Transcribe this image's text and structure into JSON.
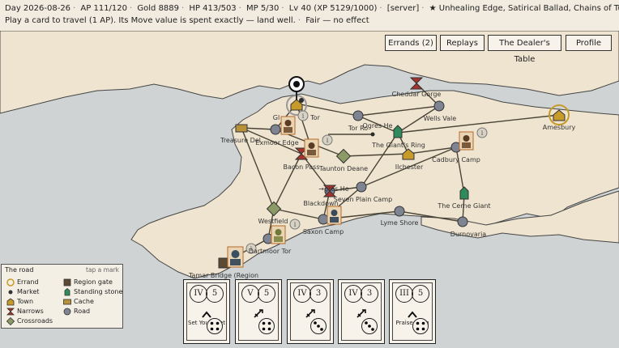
{
  "status": {
    "day": "Day 2026-08-26",
    "ap": "AP 111/120",
    "gold": "Gold 8889",
    "hp": "HP 413/503",
    "mp": "MP 5/30",
    "level": "Lv 40 (XP 5129/1000)",
    "server": "[server]",
    "traits": "★ Unhealing Edge, Satirical Ballad, Chains of Turquine",
    "message": "Play a card to travel (1 AP). Its Move value is spent exactly — land well.",
    "weather": "Fair — no effect"
  },
  "nav": {
    "errands": "Errands (2)",
    "replays": "Replays",
    "dealers_table": "The Dealer's Table",
    "profile": "Profile"
  },
  "places": {
    "cheddar": "Cheddar Gorge",
    "wells": "Wells Vale",
    "amesbury": "Amesbury",
    "tor": "Tor",
    "glastonbury": "Gl",
    "torroad": "Tor Ro",
    "ogreshe": "Ogres He",
    "giants_ring": "The Giant's Ring",
    "exmoor": "Exmoor Edge",
    "treasure": "Treasure Del",
    "ilchester": "Ilchester",
    "cadbury": "Cadbury Camp",
    "bacon": "Bacon Pass",
    "taunton": "Taunton Deane",
    "ogres_h2": "→gres He",
    "blackdown": "Blackdown",
    "seven": "Seven Plain Camp",
    "cerne": "The Cerne Giant",
    "westfield": "Westfield",
    "lyme": "Lyme Shore",
    "saxon": "Saxon Camp",
    "dartmoor": "Dartmoor Tor",
    "durnovaria": "Durnovaria",
    "tamar": "Tamar Bridge (Region"
  },
  "legend": {
    "title": "The road",
    "hint": "tap a mark",
    "items": [
      "Errand",
      "Market",
      "Town",
      "Narrows",
      "Crossroads",
      "Region gate",
      "Standing stone",
      "Cache",
      "Road"
    ]
  },
  "cards": [
    {
      "rank": "IV",
      "move": "5",
      "name": "Set Your Feet",
      "icon": "chevron",
      "die": 4
    },
    {
      "rank": "V",
      "move": "5",
      "name": "",
      "icon": "sword",
      "die": 4
    },
    {
      "rank": "IV",
      "move": "3",
      "name": "",
      "icon": "sword",
      "die": 3
    },
    {
      "rank": "IV",
      "move": "3",
      "name": "",
      "icon": "sword",
      "die": 3
    },
    {
      "rank": "III",
      "move": "5",
      "name": "Praise Song",
      "icon": "chevron",
      "die": 4
    }
  ],
  "colors": {
    "sea": "#cfd3d3",
    "land": "#efe4d0",
    "road": "#4a4436",
    "town": "#c79b2a",
    "narrows": "#a6342c",
    "crossroads": "#8c9a66",
    "stone": "#2f8a5c",
    "node": "#7f8493"
  }
}
